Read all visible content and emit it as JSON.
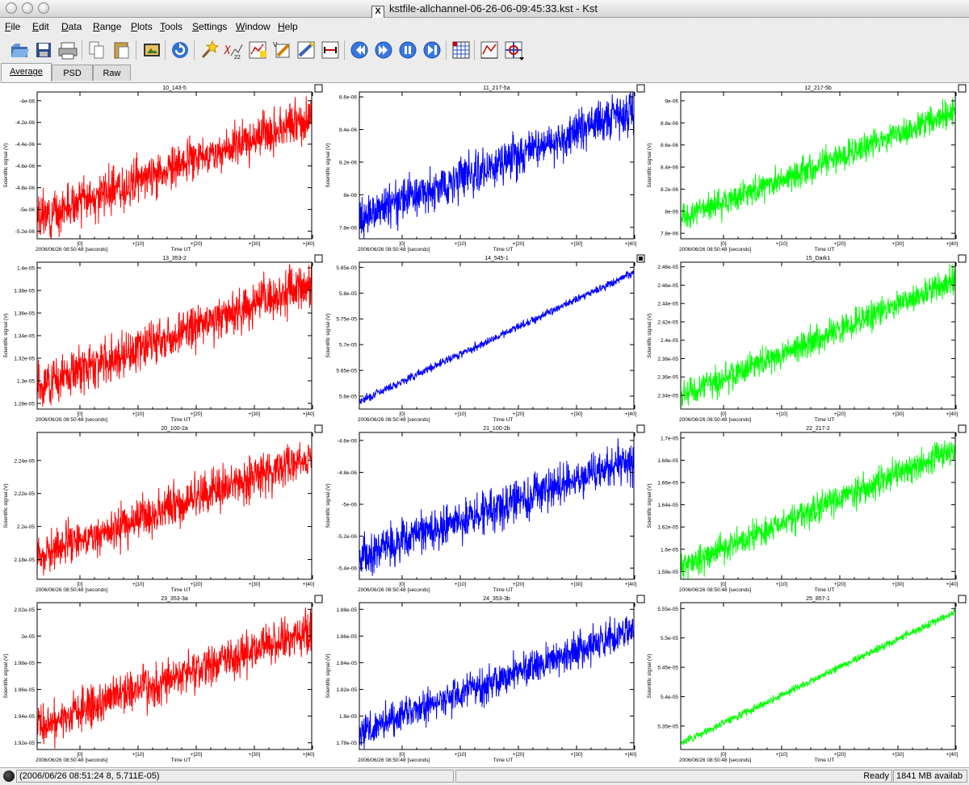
{
  "window": {
    "title": "kstfile-allchannel-06-26-06-09:45:33.kst - Kst"
  },
  "menu": [
    "File",
    "Edit",
    "Data",
    "Range",
    "Plots",
    "Tools",
    "Settings",
    "Window",
    "Help"
  ],
  "toolbar": [
    {
      "name": "open-icon"
    },
    {
      "name": "save-icon"
    },
    {
      "name": "print-icon"
    },
    {
      "name": "copy-icon"
    },
    {
      "name": "paste-icon"
    },
    {
      "name": "export-icon"
    },
    {
      "name": "reload-icon"
    },
    {
      "name": "data-wizard-icon"
    },
    {
      "name": "plugin-icon"
    },
    {
      "name": "new-plot-icon"
    },
    {
      "name": "new-vector-icon"
    },
    {
      "name": "edit-plot-icon"
    },
    {
      "name": "zoom-range-icon"
    },
    {
      "name": "back-icon"
    },
    {
      "name": "forward-icon"
    },
    {
      "name": "pause-icon"
    },
    {
      "name": "end-icon"
    },
    {
      "name": "layout-mode-icon"
    },
    {
      "name": "xy-zoom-icon"
    },
    {
      "name": "graphics-mode-icon"
    }
  ],
  "tabs": [
    {
      "label": "Average",
      "active": true
    },
    {
      "label": "PSD",
      "active": false
    },
    {
      "label": "Raw",
      "active": false
    }
  ],
  "common": {
    "xlabel": "Time UT",
    "ylabel": "Scientific signal (V)",
    "x_origin_label": "2006/06/26 08:50:48 [seconds]",
    "x_ticks": [
      "[0]",
      "+[10]",
      "+[20]",
      "+[30]",
      "+[40]"
    ]
  },
  "plots": [
    {
      "title": "10_143-5",
      "color": "#ff0000",
      "y_ticks": [
        "-4e-06",
        "-4.2e-06",
        "-4.4e-06",
        "-4.6e-06",
        "-4.8e-06",
        "-5e-06",
        "-5.2e-06"
      ],
      "y_tick_vals": [
        -4e-06,
        -4.2e-06,
        -4.4e-06,
        -4.6e-06,
        -4.8e-06,
        -5e-06,
        -5.2e-06
      ],
      "ylim": [
        -5.27e-06,
        -3.92e-06
      ],
      "start": -5.08e-06,
      "end": -4.15e-06,
      "noise": 1.5e-07,
      "checked": false
    },
    {
      "title": "11_217-5a",
      "color": "#0000ff",
      "y_ticks": [
        "8.6e-06",
        "8.4e-06",
        "8.2e-06",
        "8e-06",
        "7.8e-06"
      ],
      "y_tick_vals": [
        8.6e-06,
        8.4e-06,
        8.2e-06,
        8e-06,
        7.8e-06
      ],
      "ylim": [
        7.73e-06,
        8.63e-06
      ],
      "start": 7.86e-06,
      "end": 8.52e-06,
      "noise": 1e-07,
      "checked": false
    },
    {
      "title": "12_217-5b",
      "color": "#00ff00",
      "y_ticks": [
        "9e-06",
        "8.8e-06",
        "8.6e-06",
        "8.4e-06",
        "8.2e-06",
        "8e-06",
        "7.8e-06"
      ],
      "y_tick_vals": [
        9e-06,
        8.8e-06,
        8.6e-06,
        8.4e-06,
        8.2e-06,
        8e-06,
        7.8e-06
      ],
      "ylim": [
        7.75e-06,
        9.08e-06
      ],
      "start": 7.93e-06,
      "end": 8.9e-06,
      "noise": 1e-07,
      "checked": false
    },
    {
      "title": "13_353-2",
      "color": "#ff0000",
      "y_ticks": [
        "1.4e-05",
        "1.38e-05",
        "1.36e-05",
        "1.34e-05",
        "1.32e-05",
        "1.3e-05",
        "1.28e-05"
      ],
      "y_tick_vals": [
        1.4e-05,
        1.38e-05,
        1.36e-05,
        1.34e-05,
        1.32e-05,
        1.3e-05,
        1.28e-05
      ],
      "ylim": [
        1.275e-05,
        1.405e-05
      ],
      "start": 1.295e-05,
      "end": 1.387e-05,
      "noise": 1.5e-07,
      "checked": false
    },
    {
      "title": "14_545-1",
      "color": "#0000ff",
      "y_ticks": [
        "5.85e-05",
        "5.8e-05",
        "5.75e-05",
        "5.7e-05",
        "5.65e-05",
        "5.6e-05"
      ],
      "y_tick_vals": [
        5.85e-05,
        5.8e-05,
        5.75e-05,
        5.7e-05,
        5.65e-05,
        5.6e-05
      ],
      "ylim": [
        5.575e-05,
        5.86e-05
      ],
      "start": 5.59e-05,
      "end": 5.84e-05,
      "noise": 6e-08,
      "checked": true
    },
    {
      "title": "15_Dark1",
      "color": "#00ff00",
      "y_ticks": [
        "2.48e-05",
        "2.46e-05",
        "2.44e-05",
        "2.42e-05",
        "2.4e-05",
        "2.38e-05",
        "2.36e-05",
        "2.34e-05"
      ],
      "y_tick_vals": [
        2.48e-05,
        2.46e-05,
        2.44e-05,
        2.42e-05,
        2.4e-05,
        2.38e-05,
        2.36e-05,
        2.34e-05
      ],
      "ylim": [
        2.325e-05,
        2.485e-05
      ],
      "start": 2.338e-05,
      "end": 2.465e-05,
      "noise": 1.2e-07,
      "checked": false
    },
    {
      "title": "20_100-2a",
      "color": "#ff0000",
      "y_ticks": [
        "2.24e-05",
        "2.22e-05",
        "2.2e-05",
        "2.18e-05"
      ],
      "y_tick_vals": [
        2.24e-05,
        2.22e-05,
        2.2e-05,
        2.18e-05
      ],
      "ylim": [
        2.168e-05,
        2.257e-05
      ],
      "start": 2.182e-05,
      "end": 2.243e-05,
      "noise": 1e-07,
      "checked": false
    },
    {
      "title": "21_100-2b",
      "color": "#0000ff",
      "y_ticks": [
        "-4.6e-06",
        "-4.8e-06",
        "-5e-06",
        "-5.2e-06",
        "-5.4e-06"
      ],
      "y_tick_vals": [
        -4.6e-06,
        -4.8e-06,
        -5e-06,
        -5.2e-06,
        -5.4e-06
      ],
      "ylim": [
        -5.47e-06,
        -4.55e-06
      ],
      "start": -5.33e-06,
      "end": -4.72e-06,
      "noise": 1e-07,
      "checked": false
    },
    {
      "title": "22_217-2",
      "color": "#00ff00",
      "y_ticks": [
        "1.7e-05",
        "1.68e-05",
        "1.66e-05",
        "1.64e-05",
        "1.62e-05",
        "1.6e-05",
        "1.58e-05"
      ],
      "y_tick_vals": [
        1.7e-05,
        1.68e-05,
        1.66e-05,
        1.64e-05,
        1.62e-05,
        1.6e-05,
        1.58e-05
      ],
      "ylim": [
        1.573e-05,
        1.705e-05
      ],
      "start": 1.584e-05,
      "end": 1.69e-05,
      "noise": 1e-07,
      "checked": false
    },
    {
      "title": "23_353-3a",
      "color": "#ff0000",
      "y_ticks": [
        "2.02e-05",
        "2e-05",
        "1.98e-05",
        "1.96e-05",
        "1.94e-05",
        "1.92e-05"
      ],
      "y_tick_vals": [
        2.02e-05,
        2e-05,
        1.98e-05,
        1.96e-05,
        1.94e-05,
        1.92e-05
      ],
      "ylim": [
        1.915e-05,
        2.025e-05
      ],
      "start": 1.932e-05,
      "end": 2.005e-05,
      "noise": 1.2e-07,
      "checked": false
    },
    {
      "title": "24_353-3b",
      "color": "#0000ff",
      "y_ticks": [
        "1.88e-05",
        "1.86e-05",
        "1.84e-05",
        "1.82e-05",
        "1.8e-05",
        "1.78e-05"
      ],
      "y_tick_vals": [
        1.88e-05,
        1.86e-05,
        1.84e-05,
        1.82e-05,
        1.8e-05,
        1.78e-05
      ],
      "ylim": [
        1.775e-05,
        1.885e-05
      ],
      "start": 1.788e-05,
      "end": 1.865e-05,
      "noise": 1e-07,
      "checked": false
    },
    {
      "title": "25_857-1",
      "color": "#00ff00",
      "y_ticks": [
        "5.55e-05",
        "5.5e-05",
        "5.45e-05",
        "5.4e-05",
        "5.35e-05"
      ],
      "y_tick_vals": [
        5.55e-05,
        5.5e-05,
        5.45e-05,
        5.4e-05,
        5.35e-05
      ],
      "ylim": [
        5.31e-05,
        5.56e-05
      ],
      "start": 5.32e-05,
      "end": 5.545e-05,
      "noise": 5e-08,
      "checked": false
    }
  ],
  "status": {
    "coords": "(2006/06/26 08:51:24 8, 5.711E-05)",
    "state": "Ready",
    "memory": "1841 MB availab"
  }
}
